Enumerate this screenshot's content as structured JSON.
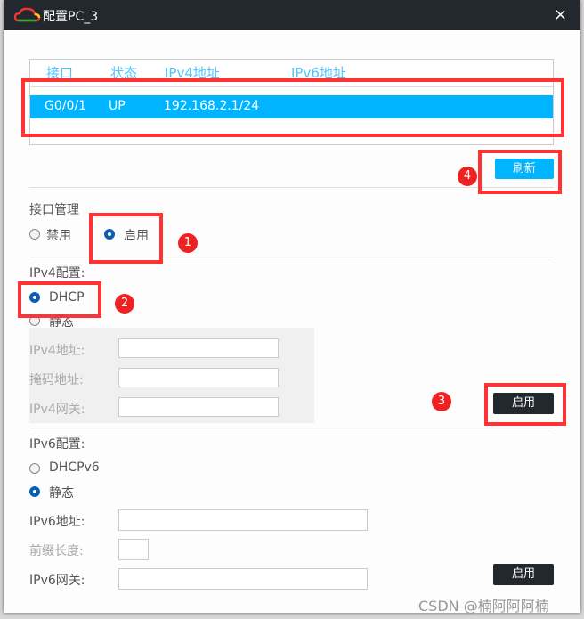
{
  "window": {
    "title": "配置PC_3",
    "close": "×"
  },
  "table": {
    "headers": [
      "接口",
      "状态",
      "IPv4地址",
      "IPv6地址"
    ],
    "rows": [
      {
        "interface": "G0/0/1",
        "status": "UP",
        "ipv4": "192.168.2.1/24",
        "ipv6": ""
      }
    ],
    "selected_row": 0
  },
  "refresh_button": "刷新",
  "interface_mgmt": {
    "label": "接口管理",
    "options": [
      "禁用",
      "启用"
    ],
    "selected": "启用"
  },
  "ipv4": {
    "label": "IPv4配置:",
    "options": [
      "DHCP",
      "静态"
    ],
    "selected": "DHCP",
    "address_label": "IPv4地址:",
    "mask_label": "掩码地址:",
    "gateway_label": "IPv4网关:",
    "address": "",
    "mask": "",
    "gateway": "",
    "apply": "启用"
  },
  "ipv6": {
    "label": "IPv6配置:",
    "options": [
      "DHCPv6",
      "静态"
    ],
    "selected": "静态",
    "address_label": "IPv6地址:",
    "prefix_label": "前缀长度:",
    "gateway_label": "IPv6网关:",
    "address": "",
    "prefix": "",
    "gateway": "",
    "apply": "启用"
  },
  "annotations": [
    "1",
    "2",
    "3",
    "4"
  ],
  "watermark": "CSDN @楠阿阿阿楠",
  "colors": {
    "accent": "#00b4ff",
    "titlebar": "#23272e",
    "annotation": "#ff3333",
    "radio": "#0a5fb4"
  }
}
